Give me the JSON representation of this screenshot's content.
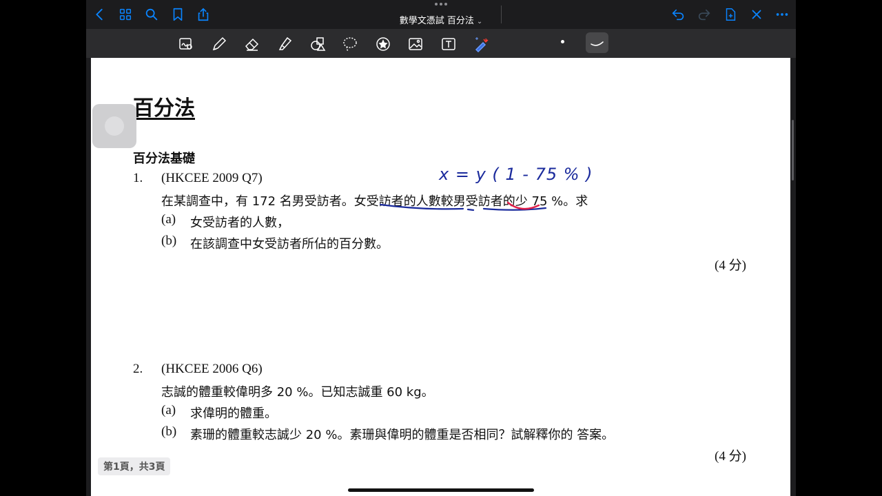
{
  "navbar": {
    "title": "數學文憑試 百分法",
    "title_chevron": "⌄",
    "left_icons": [
      "back-icon",
      "grid-icon",
      "search-icon",
      "bookmark-icon",
      "share-icon"
    ],
    "right_icons": [
      "undo-icon",
      "redo-icon",
      "add-page-icon",
      "close-icon",
      "more-icon"
    ]
  },
  "toolbar": {
    "tools": [
      "zoom-window-icon",
      "pen-icon",
      "eraser-icon",
      "highlighter-icon",
      "shapes-icon",
      "lasso-icon",
      "sticker-icon",
      "image-icon",
      "text-icon",
      "laser-pointer-icon"
    ]
  },
  "page": {
    "title": "百分法",
    "section": "百分法基礎",
    "q1": {
      "number": "1.",
      "source": "(HKCEE 2009 Q7)",
      "stem": "在某調查中，有  172  名男受訪者。女受訪者的人數較男受訪者的少  75 %。求",
      "parts": [
        {
          "label": "(a)",
          "text": "女受訪者的人數，"
        },
        {
          "label": "(b)",
          "text": "在該調查中女受訪者所佔的百分數。"
        }
      ],
      "marks": "(4 分)"
    },
    "q2": {
      "number": "2.",
      "source": "(HKCEE 2006 Q6)",
      "stem": "志誠的體重較偉明多 20 %。已知志誠重 60 kg。",
      "parts": [
        {
          "label": "(a)",
          "text": "求偉明的體重。"
        },
        {
          "label": "(b)",
          "text": "素珊的體重較志誠少  20 %。素珊與偉明的體重是否相同？試解釋你的      答案。"
        }
      ],
      "marks": "(4 分)"
    },
    "handwriting": "x  =  y ( 1  - 75 % )",
    "page_indicator": "第1頁，共3頁"
  },
  "colors": {
    "ink_blue": "#1a2a9c",
    "highlight_red": "#e0204a",
    "accent": "#0a84ff"
  }
}
